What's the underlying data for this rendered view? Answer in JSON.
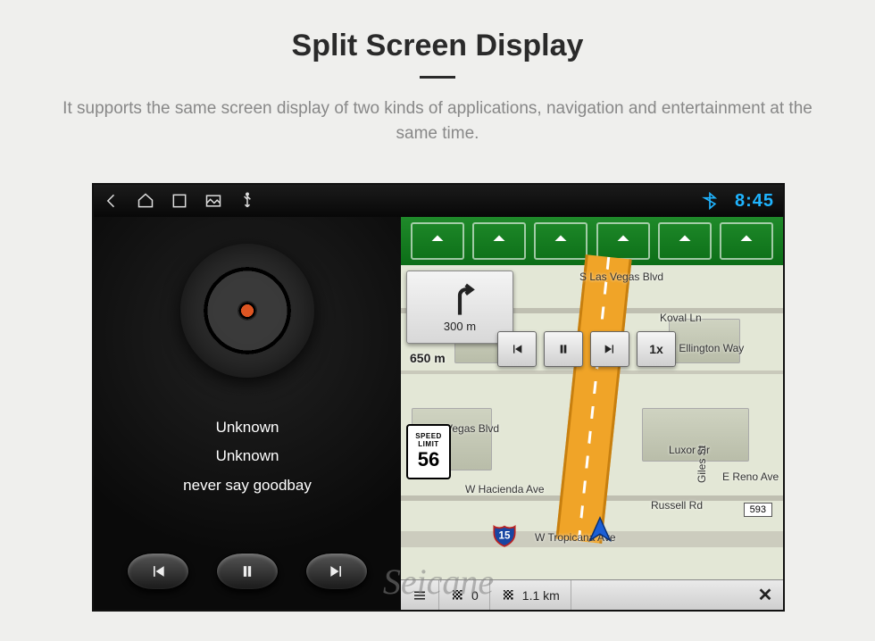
{
  "page": {
    "title": "Split Screen Display",
    "subtitle": "It supports the same screen display of two kinds of applications, navigation and entertainment at the same time."
  },
  "status_bar": {
    "clock": "8:45"
  },
  "player": {
    "line1": "Unknown",
    "line2": "Unknown",
    "line3": "never say goodbay"
  },
  "nav": {
    "turn_distance": "300 m",
    "remaining_distance": "650 m",
    "speed_limit_top1": "SPEED",
    "speed_limit_top2": "LIMIT",
    "speed_limit_value": "56",
    "interstate": "15",
    "sim_speed": "1x",
    "streets": {
      "top": "S Las Vegas Blvd",
      "koval": "Koval Ln",
      "duke": "Duke Ellington Way",
      "vegas_blvd": "Vegas Blvd",
      "luxor": "Luxor Dr",
      "hacienda": "W Hacienda Ave",
      "giles": "Giles St",
      "russell": "Russell Rd",
      "reno": "E Reno Ave",
      "tropicana": "W Tropicana Ave",
      "tropicana_num": "593"
    },
    "bottom": {
      "waypoints": "0",
      "eta_distance": "1.1 km"
    }
  },
  "watermark": "Seicane"
}
